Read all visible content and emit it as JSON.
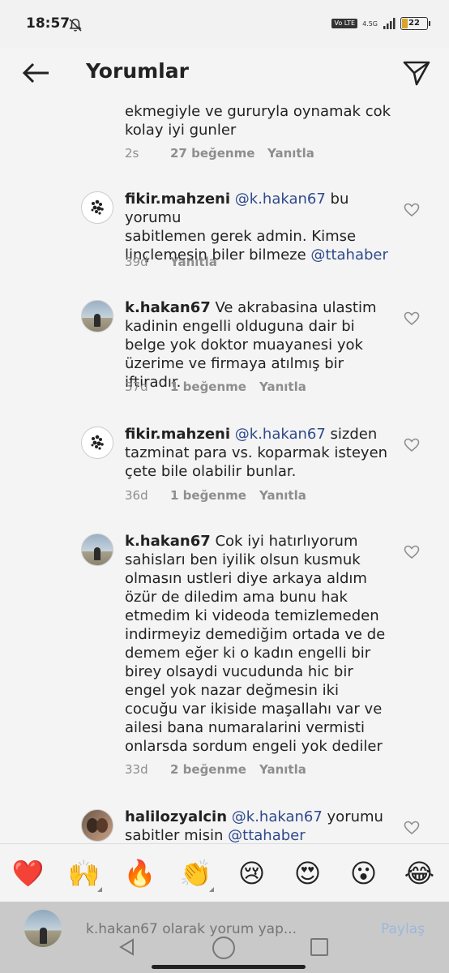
{
  "status": {
    "time": "18:57",
    "volte": "Vo LTE",
    "network": "4.5G",
    "battery": "22",
    "battery_level": 0.22
  },
  "header": {
    "title": "Yorumlar"
  },
  "comments": [
    {
      "lines": [
        "ekmegiyle ve gururyla  oynamak cok",
        "kolay iyi gunler"
      ],
      "ago": "2s",
      "likes": "27 beğenme",
      "reply": "Yanıtla"
    },
    {
      "username": "fikir.mahzeni",
      "mention1": "@k.hakan67",
      "body1": " bu yorumu",
      "line2": "sabitlemen gerek admin. Kimse",
      "line3": "linçlemesin biler bilmeze ",
      "mention2": "@ttahaber",
      "ago": "39d",
      "reply": "Yanıtla"
    },
    {
      "username": "k.hakan67",
      "body": " Ve akrabasina ulastim kadinin engelli olduguna dair bi belge yok doktor muayanesi yok üzerime ve firmaya atılmış bir iftiradır.",
      "ago": "37d",
      "likes": "1 beğenme",
      "reply": "Yanıtla"
    },
    {
      "username": "fikir.mahzeni",
      "mention1": "@k.hakan67",
      "body": " sizden tazminat para vs. koparmak isteyen çete bile olabilir bunlar.",
      "ago": "36d",
      "likes": "1 beğenme",
      "reply": "Yanıtla"
    },
    {
      "username": "k.hakan67",
      "body": " Cok iyi hatırlıyorum sahisları ben iyilik olsun kusmuk olmasın ustleri diye arkaya aldım özür de diledim ama bunu hak etmedim ki videoda temizlemeden indirmeyiz demediğim ortada ve de demem eğer ki o kadın engelli bir birey olsaydi vucudunda hic bir engel yok nazar değmesin iki cocuğu var ikiside maşallahı var ve ailesi bana numaralarini vermisti onlarsda sordum engeli yok dediler",
      "ago": "33d",
      "likes": "2 beğenme",
      "reply": "Yanıtla"
    },
    {
      "username": "halilozyalcin",
      "mention1": "@k.hakan67",
      "body1": " yorumu",
      "line2": "sabitler misin ",
      "mention2": "@ttahaber"
    }
  ],
  "emojis": [
    "❤️",
    "🙌",
    "🔥",
    "👏",
    "😢",
    "😍",
    "😮",
    "😂"
  ],
  "composer": {
    "placeholder": "k.hakan67 olarak yorum yap...",
    "share": "Paylaş"
  }
}
